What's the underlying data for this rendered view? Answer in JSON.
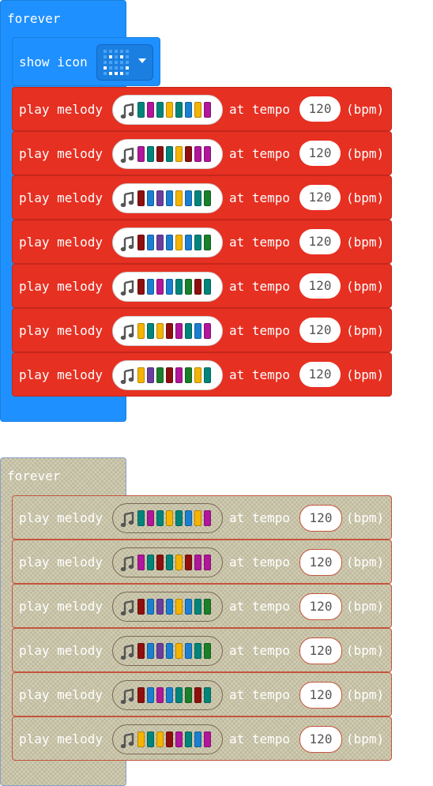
{
  "colors": {
    "event_blue": "#1e90ff",
    "melody_red": "#e63022",
    "disabled_fill": "#c9c5a0",
    "note_colors": {
      "teal": "#00857a",
      "magenta": "#b1169b",
      "maroon": "#8f0f0f",
      "orange": "#f4b400",
      "blue": "#1a7fd0",
      "purple": "#6a3ea1",
      "green": "#1a7f2a"
    }
  },
  "groups": [
    {
      "event_label": "forever",
      "disabled": false,
      "show_icon": {
        "label": "show icon",
        "icon_name": "smiley-icon"
      },
      "melodies": [
        {
          "play_label": "play melody",
          "tempo_label": "at tempo",
          "tempo": "120",
          "unit": "(bpm)",
          "notes": [
            "teal",
            "magenta",
            "teal",
            "orange",
            "teal",
            "blue",
            "orange",
            "magenta"
          ]
        },
        {
          "play_label": "play melody",
          "tempo_label": "at tempo",
          "tempo": "120",
          "unit": "(bpm)",
          "notes": [
            "magenta",
            "teal",
            "maroon",
            "teal",
            "orange",
            "maroon",
            "magenta",
            "magenta"
          ]
        },
        {
          "play_label": "play melody",
          "tempo_label": "at tempo",
          "tempo": "120",
          "unit": "(bpm)",
          "notes": [
            "maroon",
            "blue",
            "purple",
            "blue",
            "orange",
            "blue",
            "teal",
            "green"
          ]
        },
        {
          "play_label": "play melody",
          "tempo_label": "at tempo",
          "tempo": "120",
          "unit": "(bpm)",
          "notes": [
            "maroon",
            "blue",
            "purple",
            "blue",
            "orange",
            "blue",
            "teal",
            "green"
          ]
        },
        {
          "play_label": "play melody",
          "tempo_label": "at tempo",
          "tempo": "120",
          "unit": "(bpm)",
          "notes": [
            "maroon",
            "blue",
            "magenta",
            "blue",
            "teal",
            "green",
            "maroon",
            "teal"
          ]
        },
        {
          "play_label": "play melody",
          "tempo_label": "at tempo",
          "tempo": "120",
          "unit": "(bpm)",
          "notes": [
            "orange",
            "teal",
            "orange",
            "maroon",
            "magenta",
            "teal",
            "blue",
            "magenta"
          ]
        },
        {
          "play_label": "play melody",
          "tempo_label": "at tempo",
          "tempo": "120",
          "unit": "(bpm)",
          "notes": [
            "orange",
            "purple",
            "green",
            "maroon",
            "magenta",
            "green",
            "orange",
            "teal"
          ]
        }
      ]
    },
    {
      "event_label": "forever",
      "disabled": true,
      "melodies": [
        {
          "play_label": "play melody",
          "tempo_label": "at tempo",
          "tempo": "120",
          "unit": "(bpm)",
          "notes": [
            "teal",
            "magenta",
            "teal",
            "orange",
            "teal",
            "blue",
            "orange",
            "magenta"
          ]
        },
        {
          "play_label": "play melody",
          "tempo_label": "at tempo",
          "tempo": "120",
          "unit": "(bpm)",
          "notes": [
            "magenta",
            "teal",
            "maroon",
            "teal",
            "orange",
            "maroon",
            "magenta",
            "magenta"
          ]
        },
        {
          "play_label": "play melody",
          "tempo_label": "at tempo",
          "tempo": "120",
          "unit": "(bpm)",
          "notes": [
            "maroon",
            "blue",
            "purple",
            "blue",
            "orange",
            "blue",
            "teal",
            "green"
          ]
        },
        {
          "play_label": "play melody",
          "tempo_label": "at tempo",
          "tempo": "120",
          "unit": "(bpm)",
          "notes": [
            "maroon",
            "blue",
            "purple",
            "blue",
            "orange",
            "blue",
            "teal",
            "green"
          ]
        },
        {
          "play_label": "play melody",
          "tempo_label": "at tempo",
          "tempo": "120",
          "unit": "(bpm)",
          "notes": [
            "maroon",
            "blue",
            "magenta",
            "blue",
            "teal",
            "green",
            "maroon",
            "teal"
          ]
        },
        {
          "play_label": "play melody",
          "tempo_label": "at tempo",
          "tempo": "120",
          "unit": "(bpm)",
          "notes": [
            "orange",
            "teal",
            "orange",
            "maroon",
            "magenta",
            "teal",
            "blue",
            "magenta"
          ]
        }
      ]
    }
  ]
}
